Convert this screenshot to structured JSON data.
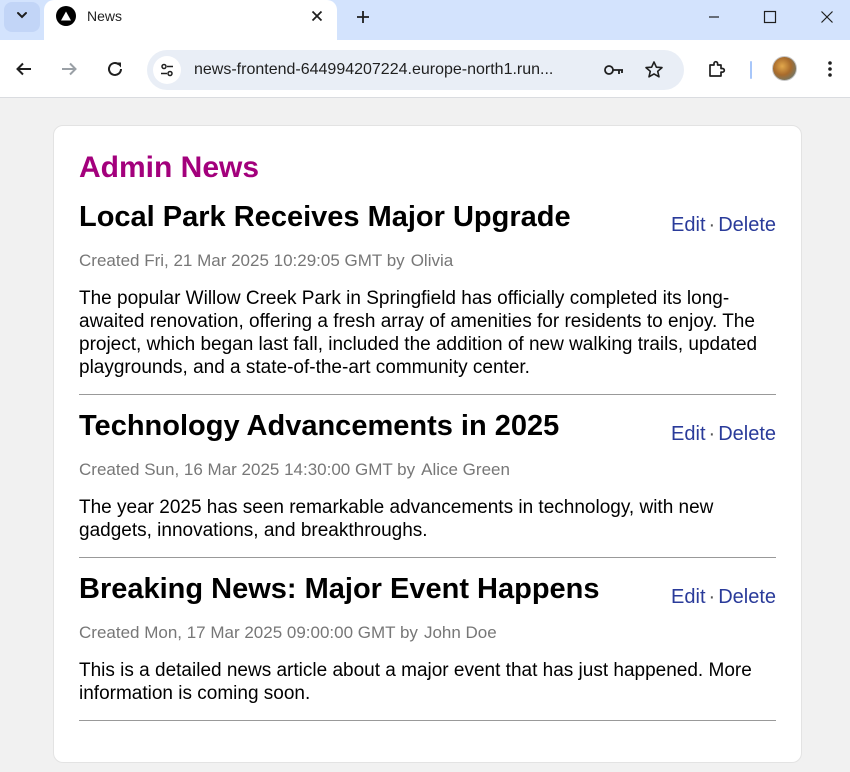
{
  "browser": {
    "tab_title": "News",
    "url": "news-frontend-644994207224.europe-north1.run..."
  },
  "page": {
    "title": "Admin News"
  },
  "articles": [
    {
      "title": "Local Park Receives Major Upgrade",
      "created_label": "Created Fri, 21 Mar 2025 10:29:05 GMT by",
      "author": "Olivia",
      "body": "The popular Willow Creek Park in Springfield has officially completed its long-awaited renovation, offering a fresh array of amenities for residents to enjoy. The project, which began last fall, included the addition of new walking trails, updated playgrounds, and a state-of-the-art community center.",
      "edit_label": "Edit",
      "separator": "·",
      "delete_label": "Delete"
    },
    {
      "title": "Technology Advancements in 2025",
      "created_label": "Created Sun, 16 Mar 2025 14:30:00 GMT by",
      "author": "Alice Green",
      "body": "The year 2025 has seen remarkable advancements in technology, with new gadgets, innovations, and breakthroughs.",
      "edit_label": "Edit",
      "separator": "·",
      "delete_label": "Delete"
    },
    {
      "title": "Breaking News: Major Event Happens",
      "created_label": "Created Mon, 17 Mar 2025 09:00:00 GMT by",
      "author": "John Doe",
      "body": "This is a detailed news article about a major event that has just happened. More information is coming soon.",
      "edit_label": "Edit",
      "separator": "·",
      "delete_label": "Delete"
    }
  ],
  "colors": {
    "title": "#a3007c",
    "link": "#2a3b9a",
    "meta": "#777777"
  }
}
